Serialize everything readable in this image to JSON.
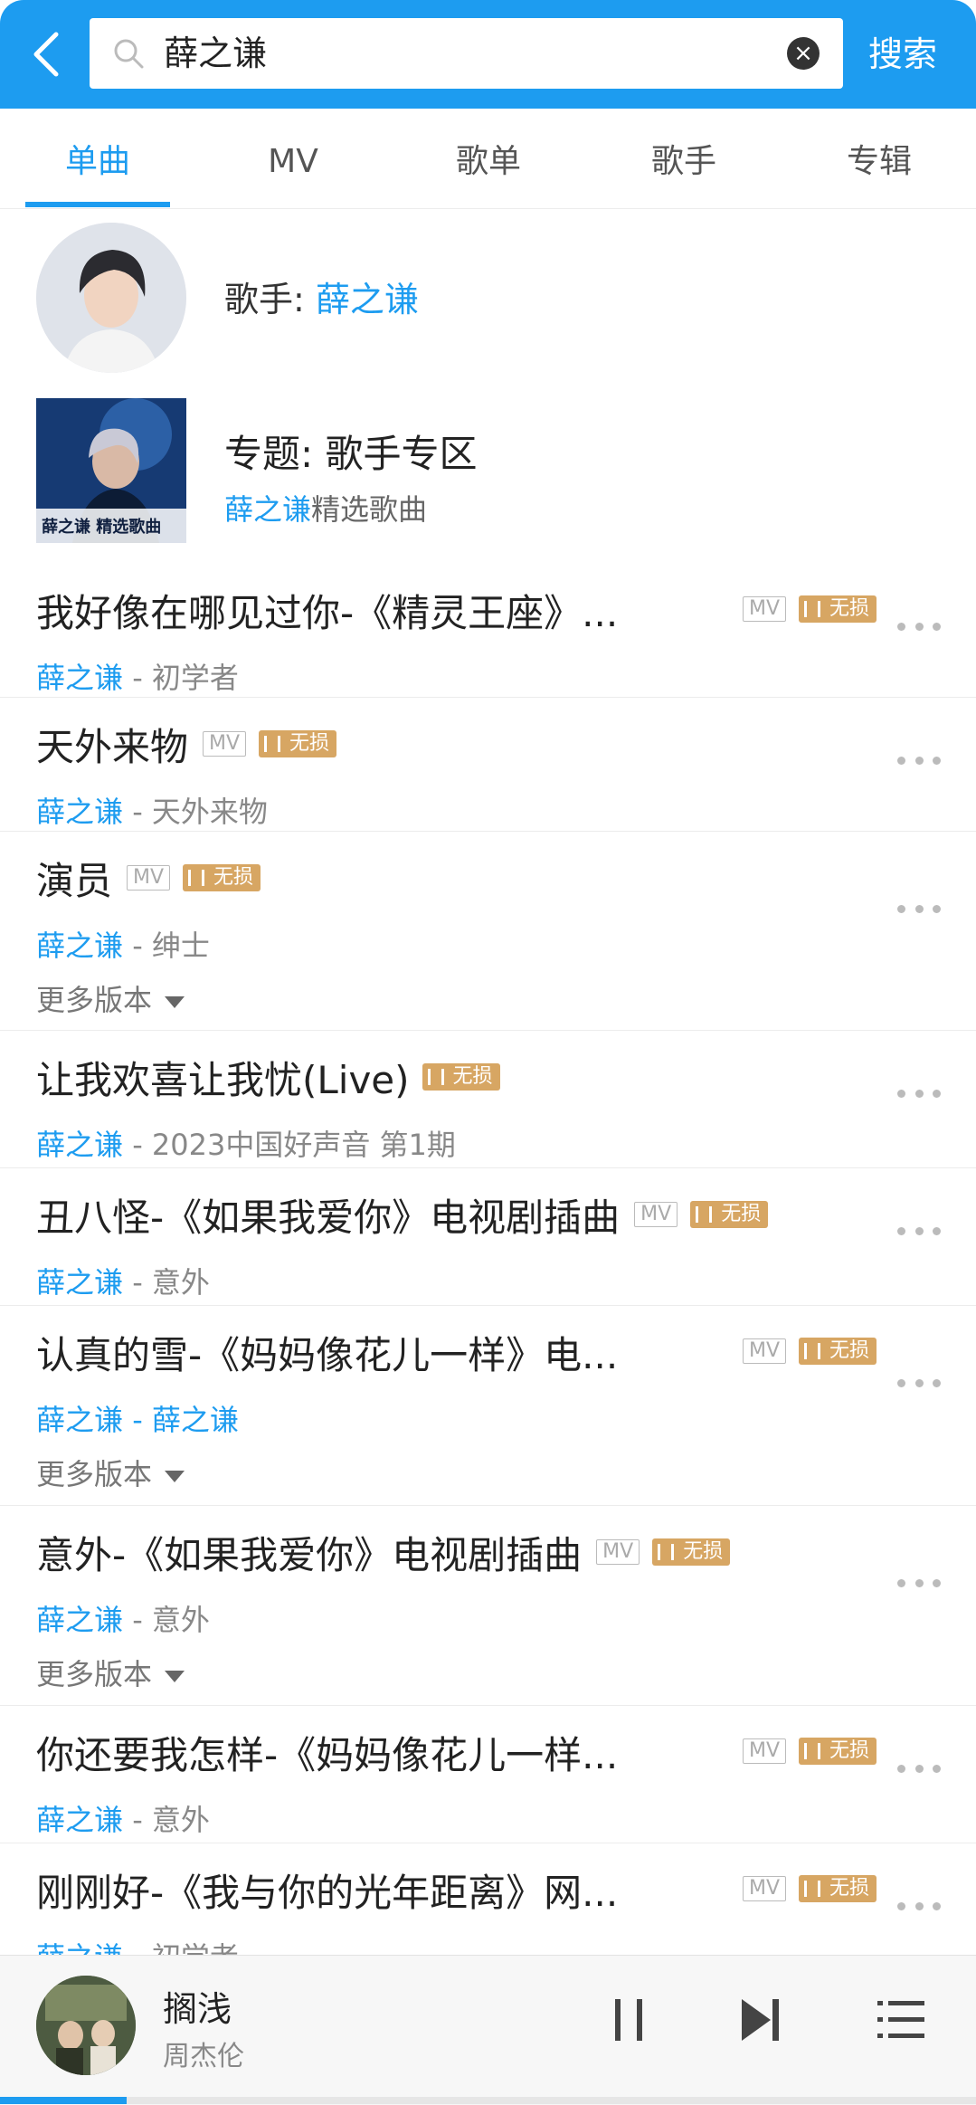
{
  "search": {
    "query": "薛之谦",
    "button_label": "搜索"
  },
  "tabs": [
    {
      "label": "单曲",
      "active": true
    },
    {
      "label": "MV",
      "active": false
    },
    {
      "label": "歌单",
      "active": false
    },
    {
      "label": "歌手",
      "active": false
    },
    {
      "label": "专辑",
      "active": false
    }
  ],
  "singer": {
    "prefix": "歌手: ",
    "name": "薛之谦"
  },
  "topic": {
    "title": "专题: 歌手专区",
    "sub_blue": "薛之谦",
    "sub_rest": "精选歌曲",
    "image_text": "薛之谦 精选歌曲"
  },
  "tags": {
    "mv": "MV",
    "lossless": "无损"
  },
  "more_versions_label": "更多版本",
  "songs": [
    {
      "title": "我好像在哪见过你-《精灵王座》...",
      "artist": "薛之谦",
      "album": " - 初学者",
      "mv": true,
      "fixed_tags": true,
      "more_versions": false
    },
    {
      "title": "天外来物",
      "artist": "薛之谦",
      "album": " - 天外来物",
      "mv": true,
      "fixed_tags": false,
      "more_versions": false
    },
    {
      "title": "演员",
      "artist": "薛之谦",
      "album": " - 绅士",
      "mv": true,
      "fixed_tags": false,
      "more_versions": true
    },
    {
      "title": "让我欢喜让我忧(Live)",
      "artist": "薛之谦",
      "album": " - 2023中国好声音 第1期",
      "mv": false,
      "fixed_tags": false,
      "more_versions": false
    },
    {
      "title": "丑八怪-《如果我爱你》电视剧插曲",
      "artist": "薛之谦",
      "album": " - 意外",
      "mv": true,
      "fixed_tags": false,
      "more_versions": false
    },
    {
      "title": "认真的雪-《妈妈像花儿一样》电...",
      "artist": "薛之谦",
      "album": " - 薛之谦",
      "album_blue": true,
      "mv": true,
      "fixed_tags": true,
      "more_versions": true
    },
    {
      "title": "意外-《如果我爱你》电视剧插曲",
      "artist": "薛之谦",
      "album": " - 意外",
      "mv": true,
      "fixed_tags": false,
      "more_versions": true
    },
    {
      "title": "你还要我怎样-《妈妈像花儿一样...",
      "artist": "薛之谦",
      "album": " - 意外",
      "mv": true,
      "fixed_tags": true,
      "more_versions": false
    },
    {
      "title": "刚刚好-《我与你的光年距离》网...",
      "artist": "薛之谦",
      "album": " - 初学者",
      "mv": true,
      "fixed_tags": true,
      "more_versions": false
    }
  ],
  "player": {
    "title": "搁浅",
    "artist": "周杰伦",
    "progress": 0.13
  },
  "colors": {
    "accent": "#1d9cf0",
    "lossless_tag": "#d7a663"
  }
}
